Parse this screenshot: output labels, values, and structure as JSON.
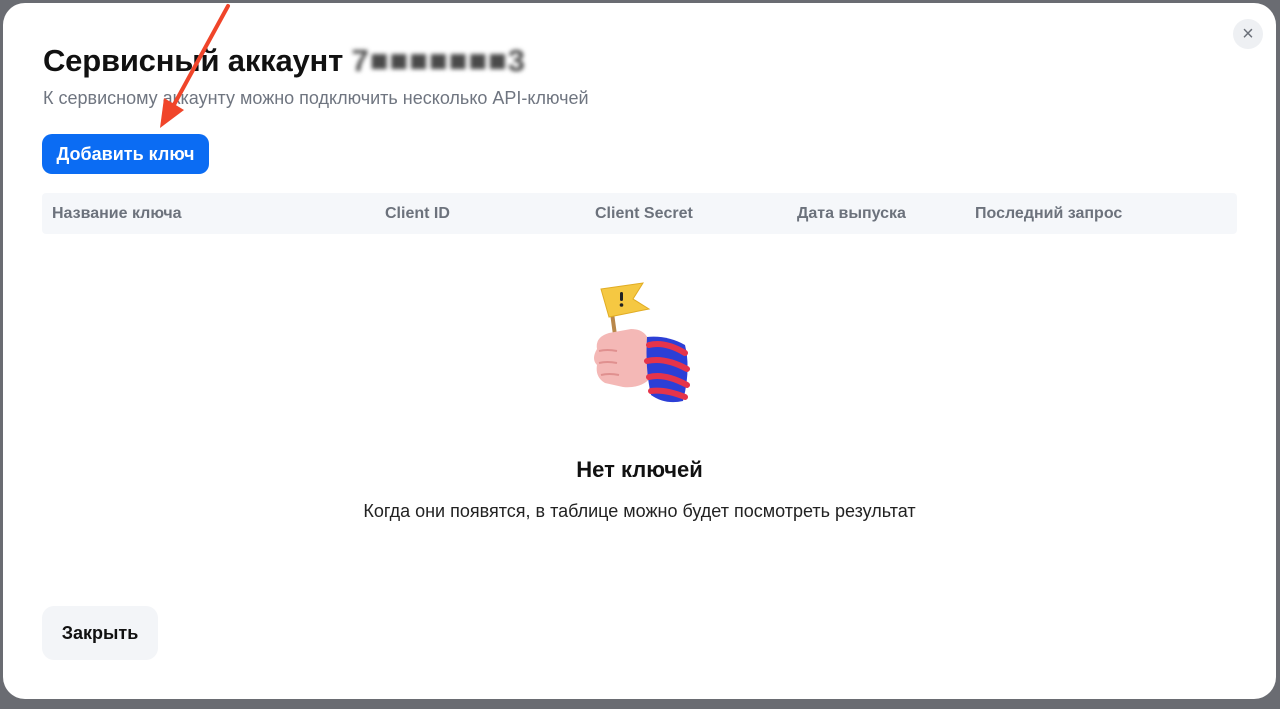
{
  "dialog": {
    "title": "Сервисный аккаунт",
    "title_masked_suffix": "7■■■■■■■3",
    "subtitle": "К сервисному аккаунту можно подключить несколько API-ключей",
    "add_button_label": "Добавить ключ",
    "close_icon": "×",
    "close_button_label": "Закрыть"
  },
  "table": {
    "columns": [
      "Название ключа",
      "Client ID",
      "Client Secret",
      "Дата выпуска",
      "Последний запрос"
    ]
  },
  "empty_state": {
    "illustration": "hand-holding-warning-flag",
    "title": "Нет ключей",
    "text": "Когда они появятся, в таблице можно будет посмотреть результат"
  },
  "annotation": {
    "icon": "red-arrow-pointer",
    "color": "#f0452a"
  },
  "colors": {
    "accent": "#0b6cf3",
    "backdrop": "#6a6c72"
  }
}
